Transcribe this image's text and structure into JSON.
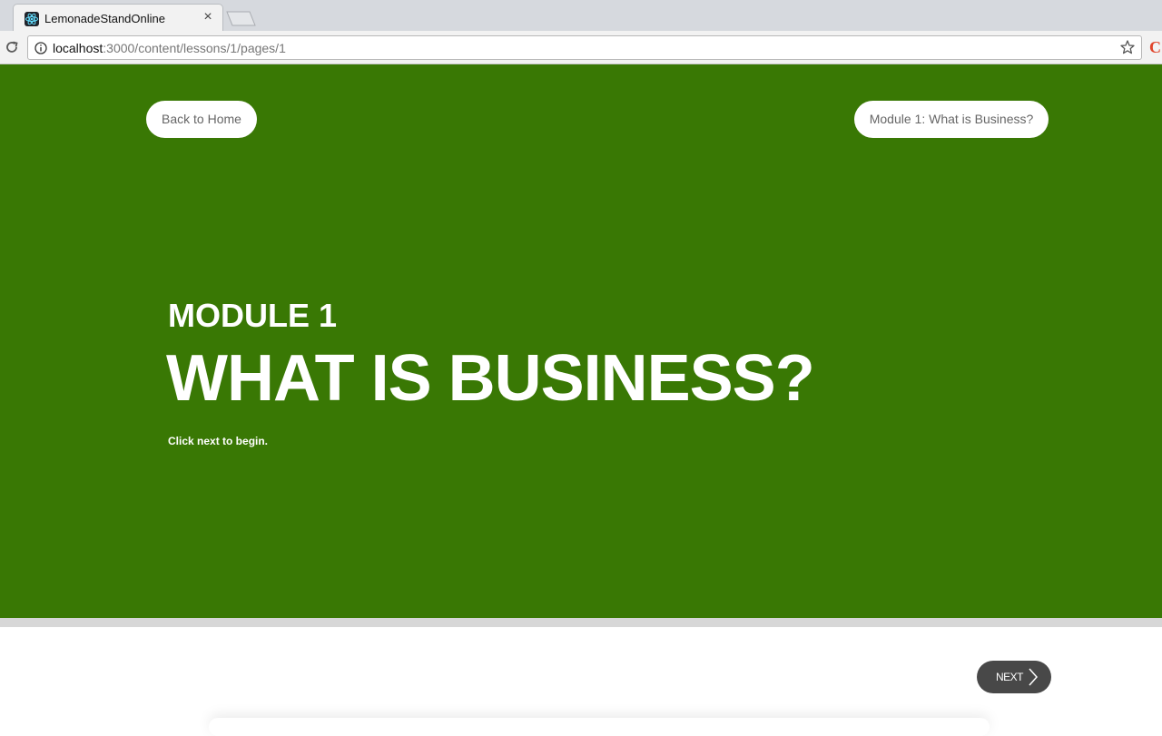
{
  "browser": {
    "tab_title": "LemonadeStandOnline",
    "url_host": "localhost",
    "url_path": ":3000/content/lessons/1/pages/1"
  },
  "icons": {
    "favicon": "react-logo-icon",
    "tab_close": "close-icon",
    "reload": "reload-icon",
    "info": "info-icon",
    "bookmark": "star-icon",
    "extension": "extension-icon",
    "next": "chevron-right-icon"
  },
  "nav": {
    "back_label": "Back to Home",
    "module_label": "Module 1: What is Business?"
  },
  "hero": {
    "kicker": "MODULE 1",
    "headline": "WHAT IS BUSINESS?",
    "hint": "Click next to begin.",
    "background_color": "#397804"
  },
  "footer": {
    "next_label": "NEXT"
  },
  "extension": {
    "glyph": "C"
  }
}
